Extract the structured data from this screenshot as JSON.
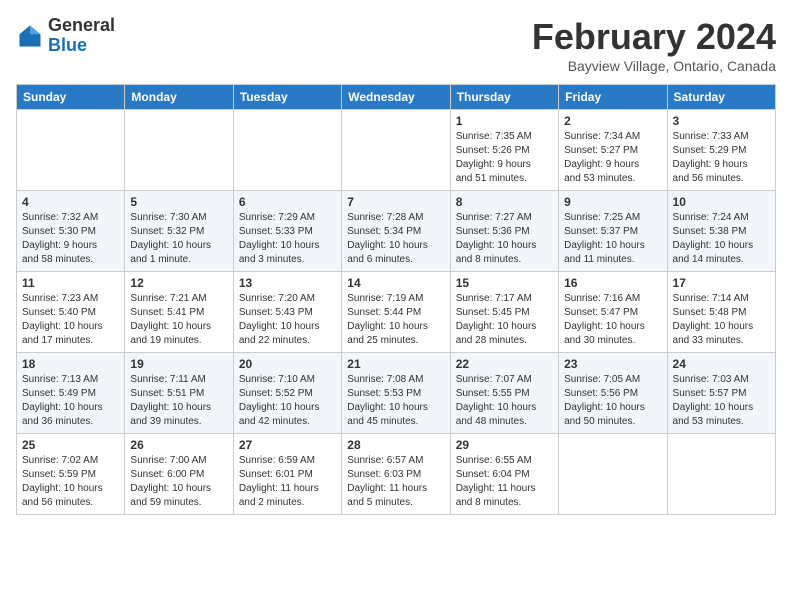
{
  "header": {
    "logo_general": "General",
    "logo_blue": "Blue",
    "month_title": "February 2024",
    "location": "Bayview Village, Ontario, Canada"
  },
  "columns": [
    "Sunday",
    "Monday",
    "Tuesday",
    "Wednesday",
    "Thursday",
    "Friday",
    "Saturday"
  ],
  "weeks": [
    [
      {
        "day": "",
        "info": ""
      },
      {
        "day": "",
        "info": ""
      },
      {
        "day": "",
        "info": ""
      },
      {
        "day": "",
        "info": ""
      },
      {
        "day": "1",
        "info": "Sunrise: 7:35 AM\nSunset: 5:26 PM\nDaylight: 9 hours\nand 51 minutes."
      },
      {
        "day": "2",
        "info": "Sunrise: 7:34 AM\nSunset: 5:27 PM\nDaylight: 9 hours\nand 53 minutes."
      },
      {
        "day": "3",
        "info": "Sunrise: 7:33 AM\nSunset: 5:29 PM\nDaylight: 9 hours\nand 56 minutes."
      }
    ],
    [
      {
        "day": "4",
        "info": "Sunrise: 7:32 AM\nSunset: 5:30 PM\nDaylight: 9 hours\nand 58 minutes."
      },
      {
        "day": "5",
        "info": "Sunrise: 7:30 AM\nSunset: 5:32 PM\nDaylight: 10 hours\nand 1 minute."
      },
      {
        "day": "6",
        "info": "Sunrise: 7:29 AM\nSunset: 5:33 PM\nDaylight: 10 hours\nand 3 minutes."
      },
      {
        "day": "7",
        "info": "Sunrise: 7:28 AM\nSunset: 5:34 PM\nDaylight: 10 hours\nand 6 minutes."
      },
      {
        "day": "8",
        "info": "Sunrise: 7:27 AM\nSunset: 5:36 PM\nDaylight: 10 hours\nand 8 minutes."
      },
      {
        "day": "9",
        "info": "Sunrise: 7:25 AM\nSunset: 5:37 PM\nDaylight: 10 hours\nand 11 minutes."
      },
      {
        "day": "10",
        "info": "Sunrise: 7:24 AM\nSunset: 5:38 PM\nDaylight: 10 hours\nand 14 minutes."
      }
    ],
    [
      {
        "day": "11",
        "info": "Sunrise: 7:23 AM\nSunset: 5:40 PM\nDaylight: 10 hours\nand 17 minutes."
      },
      {
        "day": "12",
        "info": "Sunrise: 7:21 AM\nSunset: 5:41 PM\nDaylight: 10 hours\nand 19 minutes."
      },
      {
        "day": "13",
        "info": "Sunrise: 7:20 AM\nSunset: 5:43 PM\nDaylight: 10 hours\nand 22 minutes."
      },
      {
        "day": "14",
        "info": "Sunrise: 7:19 AM\nSunset: 5:44 PM\nDaylight: 10 hours\nand 25 minutes."
      },
      {
        "day": "15",
        "info": "Sunrise: 7:17 AM\nSunset: 5:45 PM\nDaylight: 10 hours\nand 28 minutes."
      },
      {
        "day": "16",
        "info": "Sunrise: 7:16 AM\nSunset: 5:47 PM\nDaylight: 10 hours\nand 30 minutes."
      },
      {
        "day": "17",
        "info": "Sunrise: 7:14 AM\nSunset: 5:48 PM\nDaylight: 10 hours\nand 33 minutes."
      }
    ],
    [
      {
        "day": "18",
        "info": "Sunrise: 7:13 AM\nSunset: 5:49 PM\nDaylight: 10 hours\nand 36 minutes."
      },
      {
        "day": "19",
        "info": "Sunrise: 7:11 AM\nSunset: 5:51 PM\nDaylight: 10 hours\nand 39 minutes."
      },
      {
        "day": "20",
        "info": "Sunrise: 7:10 AM\nSunset: 5:52 PM\nDaylight: 10 hours\nand 42 minutes."
      },
      {
        "day": "21",
        "info": "Sunrise: 7:08 AM\nSunset: 5:53 PM\nDaylight: 10 hours\nand 45 minutes."
      },
      {
        "day": "22",
        "info": "Sunrise: 7:07 AM\nSunset: 5:55 PM\nDaylight: 10 hours\nand 48 minutes."
      },
      {
        "day": "23",
        "info": "Sunrise: 7:05 AM\nSunset: 5:56 PM\nDaylight: 10 hours\nand 50 minutes."
      },
      {
        "day": "24",
        "info": "Sunrise: 7:03 AM\nSunset: 5:57 PM\nDaylight: 10 hours\nand 53 minutes."
      }
    ],
    [
      {
        "day": "25",
        "info": "Sunrise: 7:02 AM\nSunset: 5:59 PM\nDaylight: 10 hours\nand 56 minutes."
      },
      {
        "day": "26",
        "info": "Sunrise: 7:00 AM\nSunset: 6:00 PM\nDaylight: 10 hours\nand 59 minutes."
      },
      {
        "day": "27",
        "info": "Sunrise: 6:59 AM\nSunset: 6:01 PM\nDaylight: 11 hours\nand 2 minutes."
      },
      {
        "day": "28",
        "info": "Sunrise: 6:57 AM\nSunset: 6:03 PM\nDaylight: 11 hours\nand 5 minutes."
      },
      {
        "day": "29",
        "info": "Sunrise: 6:55 AM\nSunset: 6:04 PM\nDaylight: 11 hours\nand 8 minutes."
      },
      {
        "day": "",
        "info": ""
      },
      {
        "day": "",
        "info": ""
      }
    ]
  ]
}
